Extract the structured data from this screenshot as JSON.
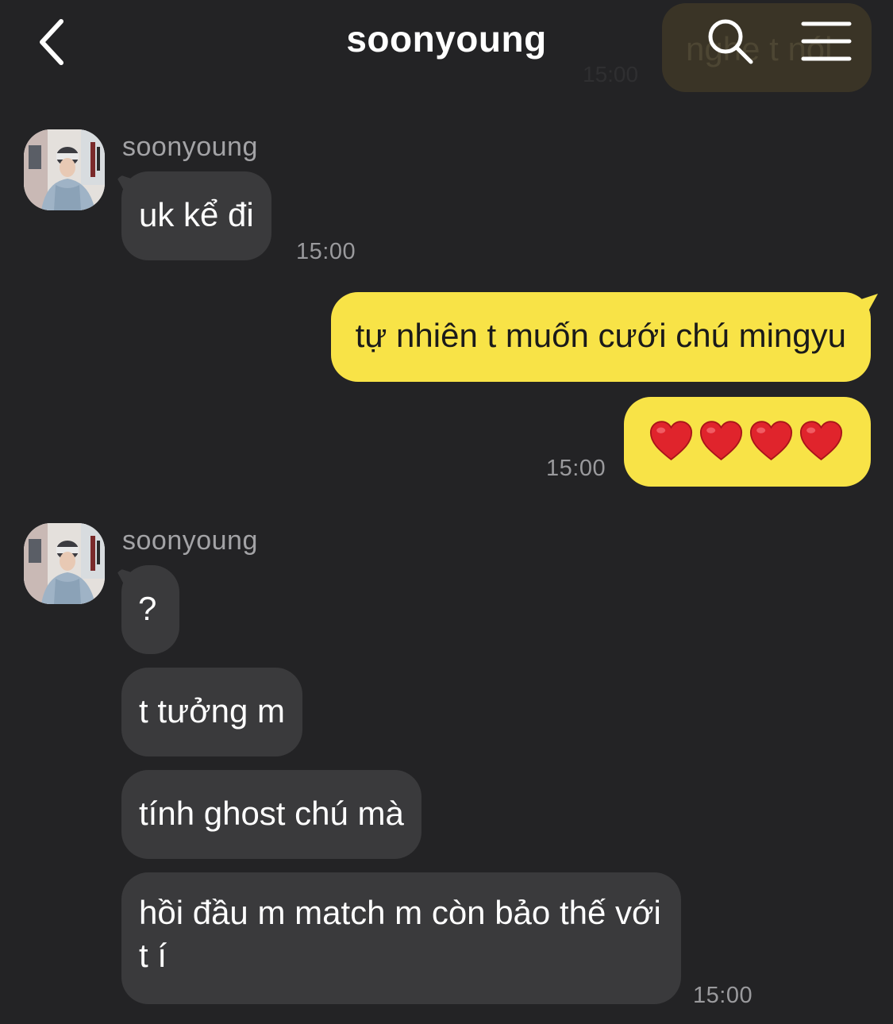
{
  "header": {
    "title": "soonyoung",
    "ghost_preview_text": "nghe t nói",
    "ghost_preview_time": "15:00"
  },
  "messages": [
    {
      "sender": "soonyoung",
      "text": "uk kể đi",
      "time": "15:00"
    },
    {
      "text": "tự nhiên t muốn cưới chú mingyu"
    },
    {
      "emoji": [
        "heart",
        "heart",
        "heart",
        "heart"
      ],
      "time": "15:00"
    },
    {
      "sender": "soonyoung",
      "text": "?"
    },
    {
      "text": "t tưởng m"
    },
    {
      "text": "tính ghost chú mà"
    },
    {
      "text": "hồi đầu m match m còn bảo thế với t í",
      "time": "15:00"
    }
  ],
  "colors": {
    "background": "#232325",
    "incoming_bubble": "#3a3a3c",
    "outgoing_bubble": "#f8e347",
    "timestamp": "#9a9a9d"
  },
  "icons": {
    "back": "chevron-left-icon",
    "search": "search-icon",
    "menu": "hamburger-menu-icon",
    "heart": "red-heart-emoji"
  }
}
